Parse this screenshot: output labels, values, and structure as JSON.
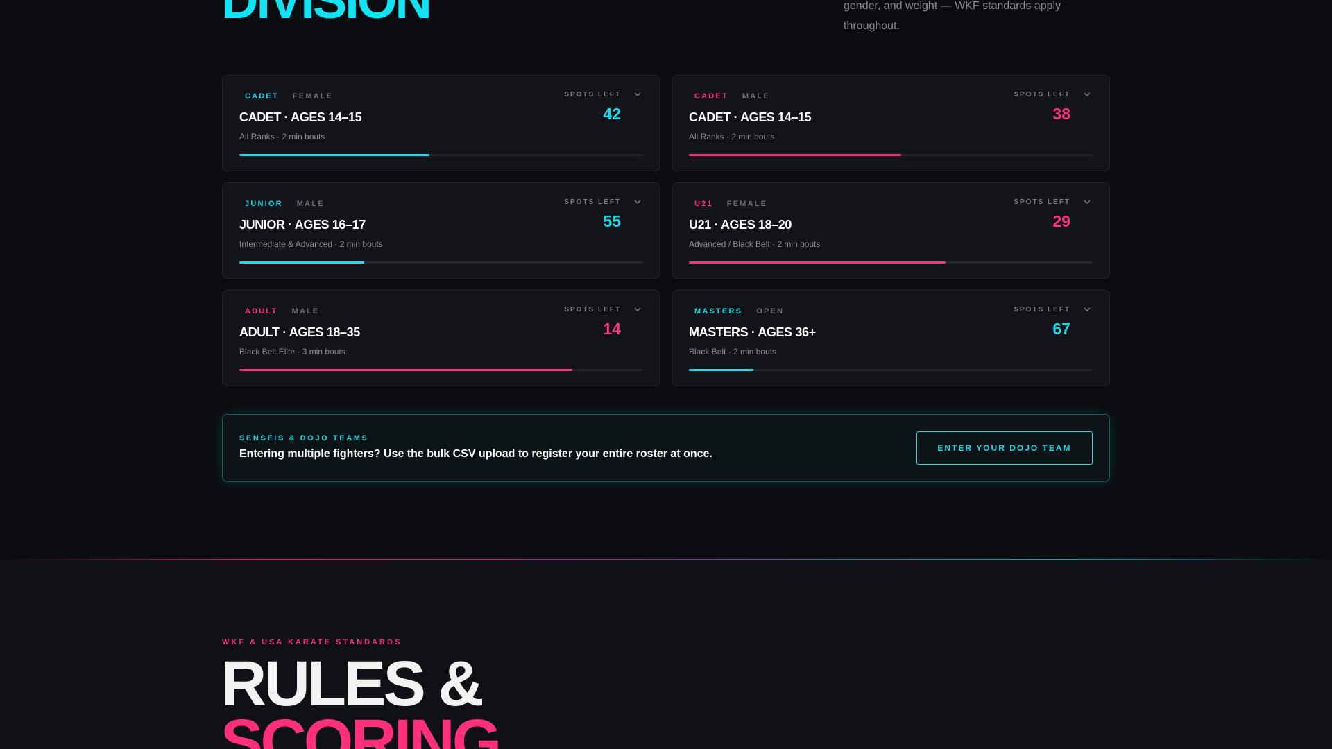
{
  "division": {
    "title": "DIVISION",
    "intro": "gender, and weight — WKF standards apply throughout."
  },
  "spots_label": "SPOTS LEFT",
  "cards": [
    {
      "tag": "CADET",
      "sub": "FEMALE",
      "title": "CADET · AGES 14–15",
      "meta": "All Ranks · 2 min bouts",
      "spots": "42",
      "accent": "#16dbe8",
      "fill_fraction": 0.47
    },
    {
      "tag": "CADET",
      "sub": "MALE",
      "title": "CADET · AGES 14–15",
      "meta": "All Ranks · 2 min bouts",
      "spots": "38",
      "accent": "#ff2f7a",
      "fill_fraction": 0.525
    },
    {
      "tag": "JUNIOR",
      "sub": "MALE",
      "title": "JUNIOR · AGES 16–17",
      "meta": "Intermediate & Advanced · 2 min bouts",
      "spots": "55",
      "accent": "#16dbe8",
      "fill_fraction": 0.31
    },
    {
      "tag": "U21",
      "sub": "FEMALE",
      "title": "U21 · AGES 18–20",
      "meta": "Advanced / Black Belt · 2 min bouts",
      "spots": "29",
      "accent": "#ff2f7a",
      "fill_fraction": 0.635
    },
    {
      "tag": "ADULT",
      "sub": "MALE",
      "title": "ADULT · AGES 18–35",
      "meta": "Black Belt Elite · 3 min bouts",
      "spots": "14",
      "accent": "#ff2f7a",
      "fill_fraction": 0.825
    },
    {
      "tag": "MASTERS",
      "sub": "OPEN",
      "title": "MASTERS · AGES 36+",
      "meta": "Black Belt · 2 min bouts",
      "spots": "67",
      "accent": "#16dbe8",
      "fill_fraction": 0.16
    }
  ],
  "banner": {
    "kicker": "SENSEIS & DOJO TEAMS",
    "text": "Entering multiple fighters? Use the bulk CSV upload to register your entire roster at once.",
    "button": "ENTER YOUR DOJO TEAM"
  },
  "rules": {
    "kicker": "WKF & USA KARATE STANDARDS",
    "title_line1": "RULES &",
    "title_line2": "SCORING"
  },
  "icons": {
    "expand": "chevron-down-icon"
  }
}
